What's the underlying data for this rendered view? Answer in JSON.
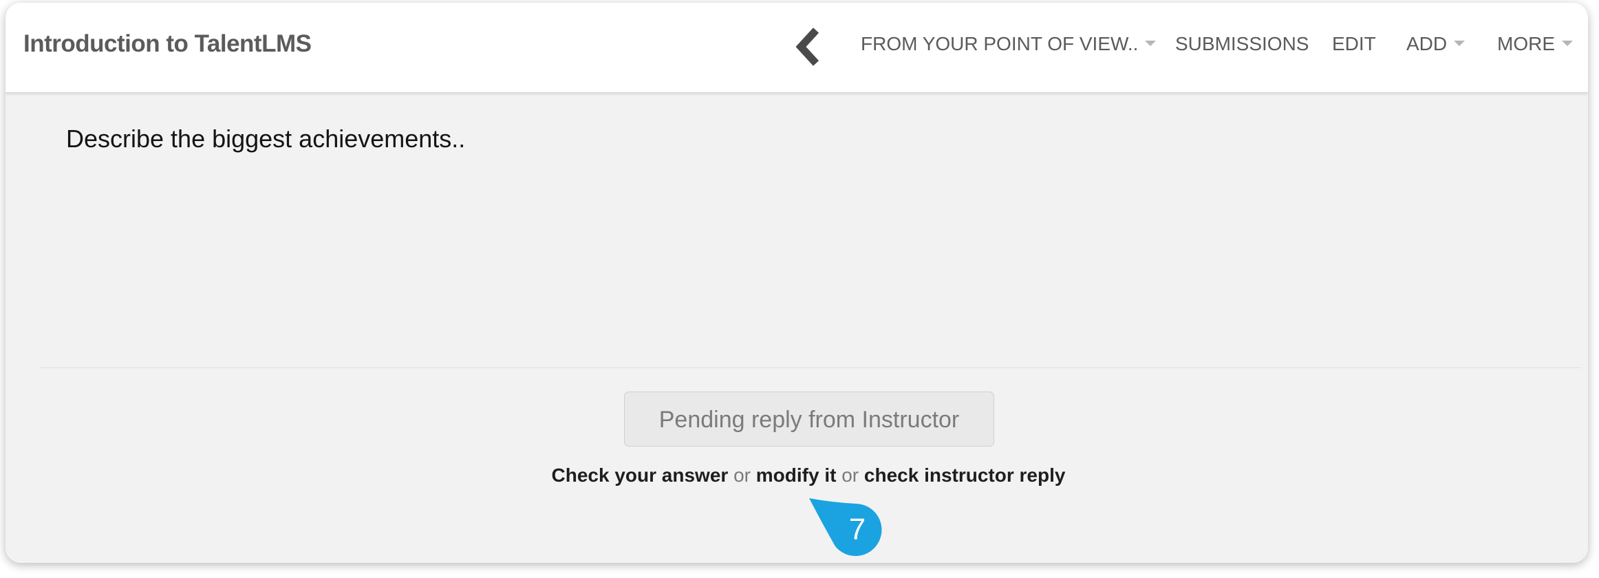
{
  "header": {
    "course_title": "Introduction to TalentLMS",
    "nav": {
      "unit_menu": "FROM YOUR POINT OF VIEW..",
      "submissions": "SUBMISSIONS",
      "edit": "EDIT",
      "add": "ADD",
      "more": "MORE"
    }
  },
  "question": {
    "text": "Describe the biggest achievements.."
  },
  "status_button": {
    "label": "Pending reply from Instructor"
  },
  "links": {
    "check_answer": "Check your answer",
    "or_1": "or",
    "modify": "modify it",
    "or_2": "or",
    "check_reply": "check instructor reply"
  },
  "step_marker": {
    "number": "7",
    "color": "#1aa3e0"
  }
}
